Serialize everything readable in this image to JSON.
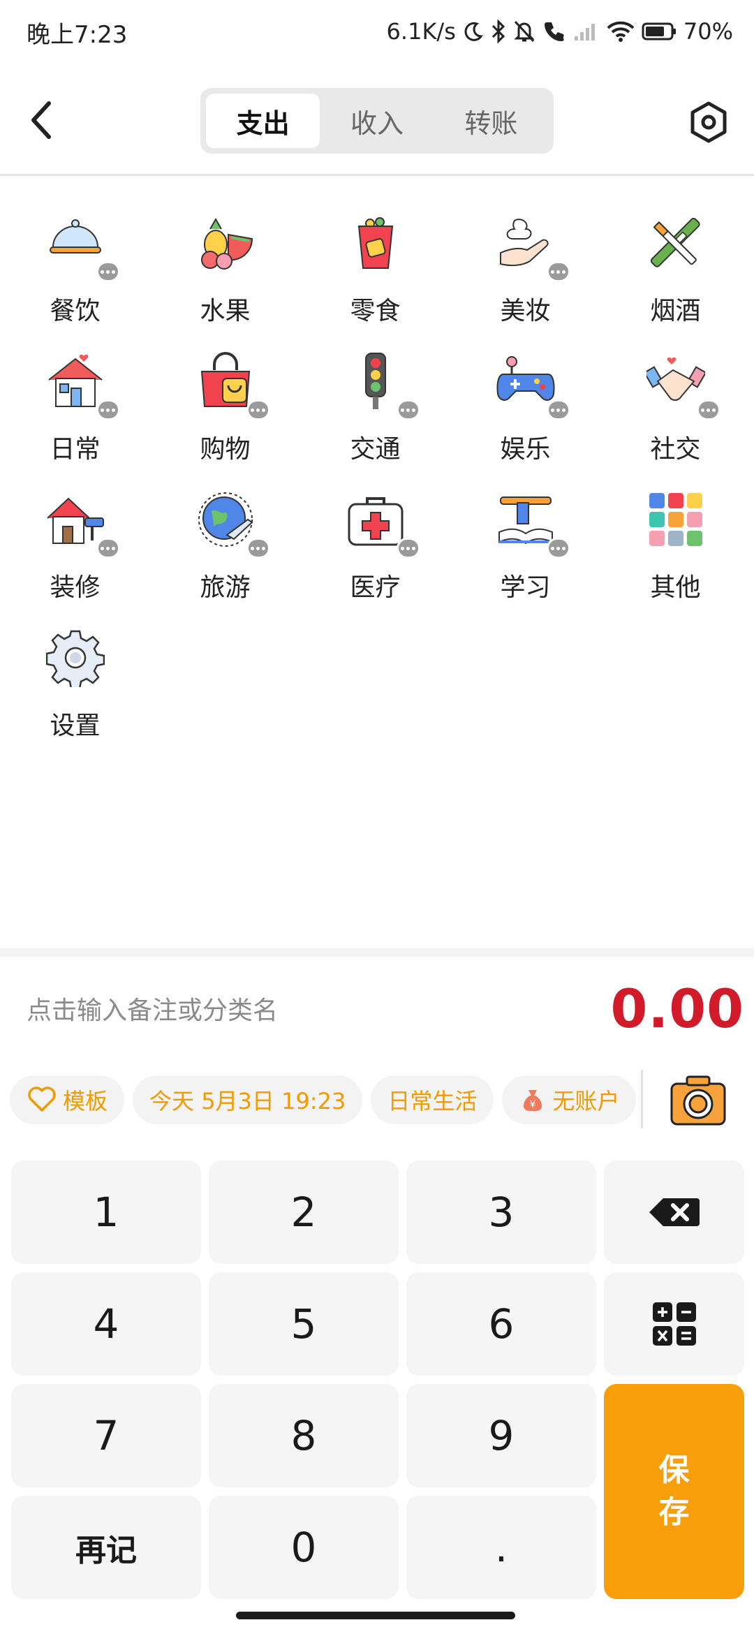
{
  "status_bar": {
    "time": "晚上7:23",
    "net_speed": "6.1K/s",
    "battery": "70%"
  },
  "header": {
    "tabs": [
      {
        "label": "支出",
        "active": true
      },
      {
        "label": "收入",
        "active": false
      },
      {
        "label": "转账",
        "active": false
      }
    ]
  },
  "categories": [
    {
      "label": "餐饮",
      "icon": "cloche-icon",
      "has_more": true
    },
    {
      "label": "水果",
      "icon": "fruit-icon",
      "has_more": false
    },
    {
      "label": "零食",
      "icon": "snack-bag-icon",
      "has_more": false
    },
    {
      "label": "美妆",
      "icon": "cream-hand-icon",
      "has_more": true
    },
    {
      "label": "烟酒",
      "icon": "bottle-cigarette-icon",
      "has_more": false
    },
    {
      "label": "日常",
      "icon": "house-icon",
      "has_more": true
    },
    {
      "label": "购物",
      "icon": "shopping-bag-icon",
      "has_more": true
    },
    {
      "label": "交通",
      "icon": "traffic-light-icon",
      "has_more": true
    },
    {
      "label": "娱乐",
      "icon": "gamepad-icon",
      "has_more": true
    },
    {
      "label": "社交",
      "icon": "handshake-icon",
      "has_more": true
    },
    {
      "label": "装修",
      "icon": "paint-house-icon",
      "has_more": true
    },
    {
      "label": "旅游",
      "icon": "globe-plane-icon",
      "has_more": true
    },
    {
      "label": "医疗",
      "icon": "first-aid-kit-icon",
      "has_more": true
    },
    {
      "label": "学习",
      "icon": "book-icon",
      "has_more": true
    },
    {
      "label": "其他",
      "icon": "color-grid-icon",
      "has_more": false
    },
    {
      "label": "设置",
      "icon": "gear-icon",
      "has_more": false
    }
  ],
  "note": {
    "placeholder": "点击输入备注或分类名",
    "amount": "0.00"
  },
  "chips": {
    "template": "模板",
    "datetime": "今天 5月3日 19:23",
    "ledger": "日常生活",
    "account": "无账户"
  },
  "keypad": {
    "keys": [
      "1",
      "2",
      "3",
      "4",
      "5",
      "6",
      "7",
      "8",
      "9",
      "再记",
      "0",
      "."
    ],
    "save_line1": "保",
    "save_line2": "存"
  },
  "colors": {
    "accent": "#f99e0b",
    "amount": "#d11a2a",
    "chip_text": "#f29a00"
  }
}
